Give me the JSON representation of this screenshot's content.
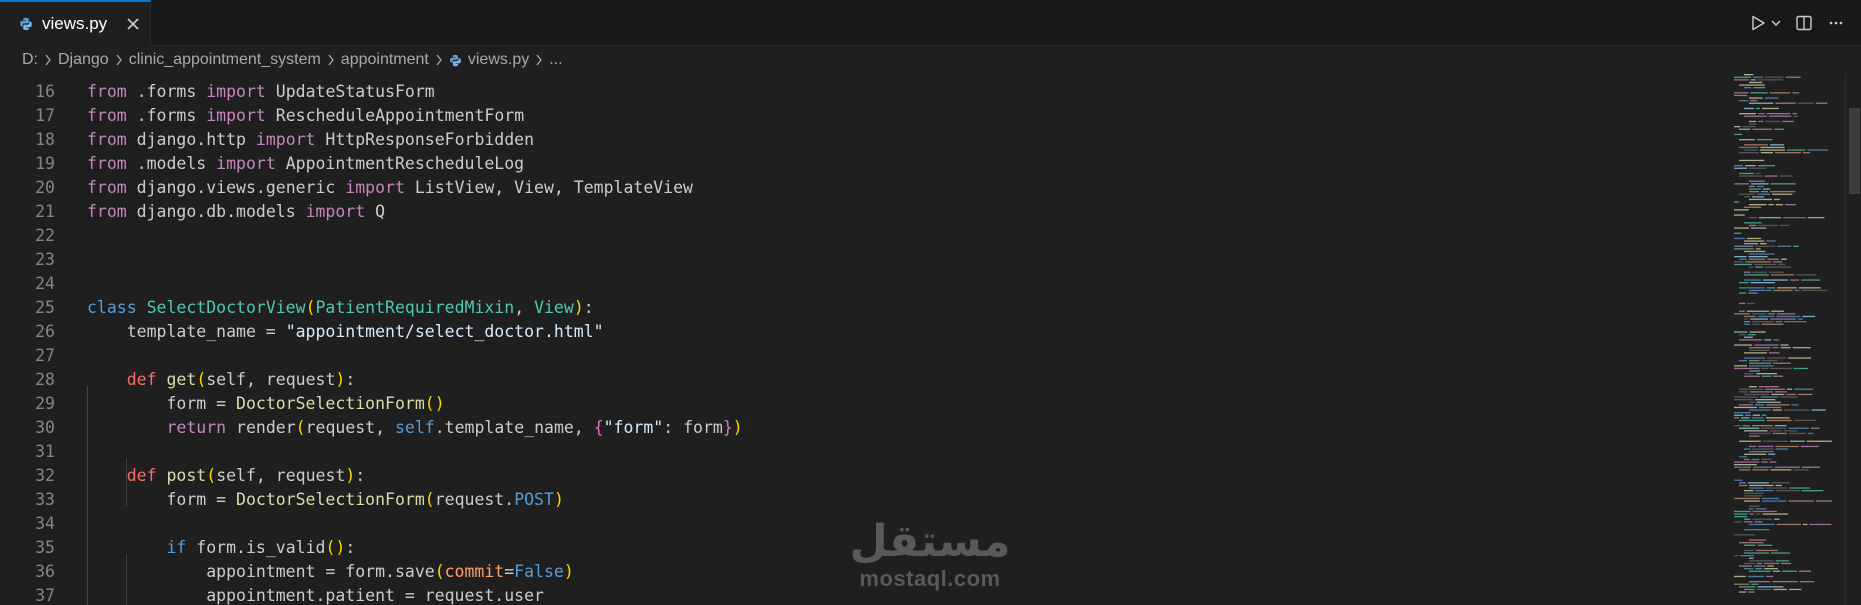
{
  "tab": {
    "filename": "views.py"
  },
  "breadcrumb": [
    "D:",
    "Django",
    "clinic_appointment_system",
    "appointment",
    "views.py",
    "..."
  ],
  "editor": {
    "lines": [
      {
        "n": "16",
        "tokens": [
          {
            "t": "from",
            "c": "kw"
          },
          {
            "t": " .forms "
          },
          {
            "t": "import",
            "c": "kw"
          },
          {
            "t": " UpdateStatusForm"
          }
        ]
      },
      {
        "n": "17",
        "tokens": [
          {
            "t": "from",
            "c": "kw"
          },
          {
            "t": " .forms "
          },
          {
            "t": "import",
            "c": "kw"
          },
          {
            "t": " RescheduleAppointmentForm"
          }
        ]
      },
      {
        "n": "18",
        "tokens": [
          {
            "t": "from",
            "c": "kw"
          },
          {
            "t": " django.http "
          },
          {
            "t": "import",
            "c": "kw"
          },
          {
            "t": " HttpResponseForbidden"
          }
        ]
      },
      {
        "n": "19",
        "tokens": [
          {
            "t": "from",
            "c": "kw"
          },
          {
            "t": " .models "
          },
          {
            "t": "import",
            "c": "kw"
          },
          {
            "t": " AppointmentRescheduleLog"
          }
        ]
      },
      {
        "n": "20",
        "tokens": [
          {
            "t": "from",
            "c": "kw"
          },
          {
            "t": " django.views.generic "
          },
          {
            "t": "import",
            "c": "kw"
          },
          {
            "t": " ListView, View, TemplateView"
          }
        ]
      },
      {
        "n": "21",
        "tokens": [
          {
            "t": "from",
            "c": "kw"
          },
          {
            "t": " django.db.models "
          },
          {
            "t": "import",
            "c": "kw"
          },
          {
            "t": " Q"
          }
        ]
      },
      {
        "n": "22",
        "tokens": []
      },
      {
        "n": "23",
        "tokens": []
      },
      {
        "n": "24",
        "tokens": []
      },
      {
        "n": "25",
        "tokens": [
          {
            "t": "class",
            "c": "kw2"
          },
          {
            "t": " "
          },
          {
            "t": "SelectDoctorView",
            "c": "cls"
          },
          {
            "t": "(",
            "c": "b1"
          },
          {
            "t": "PatientRequiredMixin",
            "c": "cls"
          },
          {
            "t": ", "
          },
          {
            "t": "View",
            "c": "cls"
          },
          {
            "t": ")",
            "c": "b1"
          },
          {
            "t": ":"
          }
        ]
      },
      {
        "n": "26",
        "tokens": [
          {
            "t": "    template_name = "
          },
          {
            "t": "\"appointment/select_doctor.html\"",
            "c": "str2"
          }
        ]
      },
      {
        "n": "27",
        "tokens": []
      },
      {
        "n": "28",
        "tokens": [
          {
            "t": "    "
          },
          {
            "t": "def",
            "c": "def"
          },
          {
            "t": " "
          },
          {
            "t": "get",
            "c": "fn"
          },
          {
            "t": "(",
            "c": "b1"
          },
          {
            "t": "self, request"
          },
          {
            "t": ")",
            "c": "b1"
          },
          {
            "t": ":"
          }
        ]
      },
      {
        "n": "29",
        "tokens": [
          {
            "t": "        form = "
          },
          {
            "t": "DoctorSelectionForm",
            "c": "fn"
          },
          {
            "t": "()",
            "c": "b1"
          }
        ]
      },
      {
        "n": "30",
        "tokens": [
          {
            "t": "        "
          },
          {
            "t": "return",
            "c": "kw"
          },
          {
            "t": " render"
          },
          {
            "t": "(",
            "c": "b1"
          },
          {
            "t": "request, "
          },
          {
            "t": "self",
            "c": "kw2"
          },
          {
            "t": ".template_name, "
          },
          {
            "t": "{",
            "c": "b2"
          },
          {
            "t": "\"form\"",
            "c": "str2"
          },
          {
            "t": ": form"
          },
          {
            "t": "}",
            "c": "b2"
          },
          {
            "t": ")",
            "c": "b1"
          }
        ]
      },
      {
        "n": "31",
        "tokens": []
      },
      {
        "n": "32",
        "tokens": [
          {
            "t": "    "
          },
          {
            "t": "def",
            "c": "def"
          },
          {
            "t": " "
          },
          {
            "t": "post",
            "c": "fn"
          },
          {
            "t": "(",
            "c": "b1"
          },
          {
            "t": "self, request"
          },
          {
            "t": ")",
            "c": "b1"
          },
          {
            "t": ":"
          }
        ]
      },
      {
        "n": "33",
        "tokens": [
          {
            "t": "        form = "
          },
          {
            "t": "DoctorSelectionForm",
            "c": "fn"
          },
          {
            "t": "(",
            "c": "b1"
          },
          {
            "t": "request."
          },
          {
            "t": "POST",
            "c": "kw2"
          },
          {
            "t": ")",
            "c": "b1"
          }
        ]
      },
      {
        "n": "34",
        "tokens": []
      },
      {
        "n": "35",
        "tokens": [
          {
            "t": "        "
          },
          {
            "t": "if",
            "c": "kw2"
          },
          {
            "t": " form.is_valid"
          },
          {
            "t": "()",
            "c": "b1"
          },
          {
            "t": ":"
          }
        ]
      },
      {
        "n": "36",
        "tokens": [
          {
            "t": "            appointment = form.save"
          },
          {
            "t": "(",
            "c": "b1"
          },
          {
            "t": "commit",
            "c": "par"
          },
          {
            "t": "="
          },
          {
            "t": "False",
            "c": "kw2"
          },
          {
            "t": ")",
            "c": "b1"
          }
        ]
      },
      {
        "n": "37",
        "tokens": [
          {
            "t": "            appointment.patient = request.user"
          }
        ]
      }
    ]
  },
  "watermark": {
    "arabic": "مستقل",
    "latin": "mostaql.com"
  },
  "icons": {
    "file": "python-icon",
    "close": "close-icon",
    "run": "run-icon",
    "split": "split-editor-icon",
    "more": "more-actions-icon"
  },
  "colors": {
    "background": "#1f1f1f",
    "tabbar": "#181818",
    "active_tab_border": "#0078d4",
    "keyword": "#c586c0",
    "class": "#4ec9b0",
    "function": "#dcdcaa"
  }
}
